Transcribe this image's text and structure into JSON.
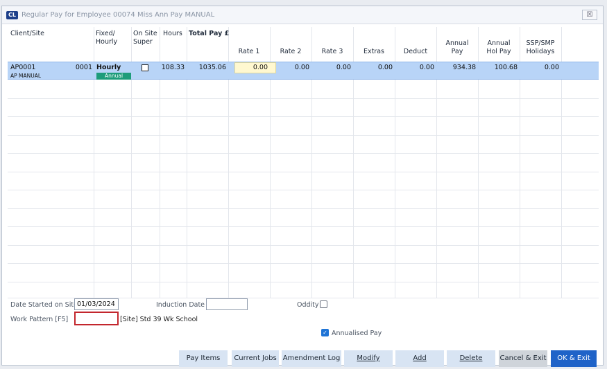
{
  "window": {
    "title": "Regular Pay for Employee 00074 Miss Ann Pay MANUAL",
    "close_glyph": "☒",
    "logo_text": "CL"
  },
  "grid": {
    "headers": {
      "client_site": "Client/Site",
      "fixed_hourly_1": "Fixed/",
      "fixed_hourly_2": "Hourly",
      "on_site_1": "On Site",
      "on_site_2": "Super",
      "hours": "Hours",
      "total_pay": "Total Pay £",
      "rate1": "Rate 1",
      "rate2": "Rate 2",
      "rate3": "Rate 3",
      "extras": "Extras",
      "deduct": "Deduct",
      "annual_pay_1": "Annual",
      "annual_pay_2": "Pay",
      "annual_hol_1": "Annual",
      "annual_hol_2": "Hol Pay",
      "ssp_1": "SSP/SMP",
      "ssp_2": "Holidays"
    },
    "row": {
      "client": "AP0001",
      "site_code": "0001",
      "site_name": "AP MANUAL",
      "fixed_hourly": "Hourly",
      "pay_type_badge": "Annual",
      "on_site_super": false,
      "hours": "108.33",
      "total_pay": "1035.06",
      "rate1": "0.00",
      "rate2": "0.00",
      "rate3": "0.00",
      "extras": "0.00",
      "deduct": "0.00",
      "annual_pay": "934.38",
      "annual_hol_pay": "100.68",
      "ssp_smp_holidays": "0.00"
    }
  },
  "form": {
    "date_started_label": "Date Started on Site",
    "date_started_value": "01/03/2024",
    "induction_date_label": "Induction Date",
    "induction_date_value": "",
    "oddity_label": "Oddity",
    "oddity_checked": false,
    "work_pattern_label": "Work Pattern [F5]",
    "work_pattern_value": "",
    "site_pattern_text": "[Site] Std 39 Wk School",
    "annualised_label": "Annualised Pay",
    "annualised_checked": true
  },
  "buttons": {
    "pay_items": "Pay Items",
    "current_jobs": "Current Jobs",
    "amendment_log": "Amendment Log",
    "modify": "Modify",
    "add": "Add",
    "delete": "Delete",
    "cancel_exit": "Cancel & Exit",
    "ok_exit": "OK & Exit"
  },
  "colors": {
    "selected_row": "#b8d4f7",
    "badge": "#1e9c7a",
    "primary_button": "#1f63c8",
    "highlight_field": "#c3262d"
  }
}
